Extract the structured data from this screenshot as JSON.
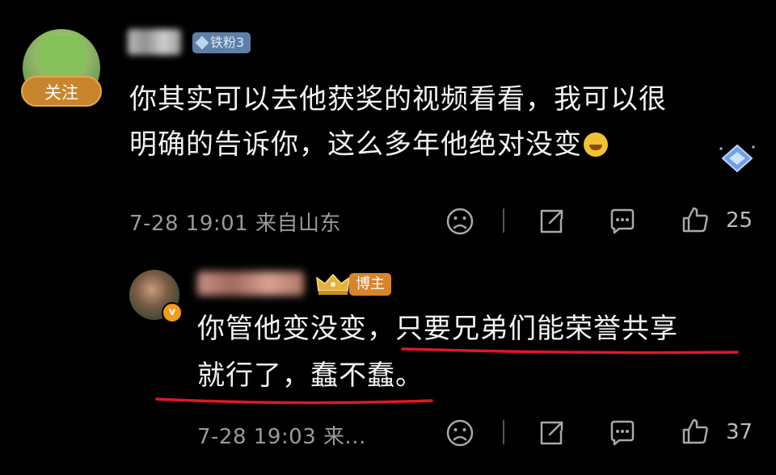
{
  "colors": {
    "background": "#000000",
    "follow": "#c9852d",
    "fan_badge": "#5f7fa8",
    "author_badge": "#d7842a",
    "underline": "#e0162b",
    "meta_text": "#9a9a9a"
  },
  "comment": {
    "follow_label": "关注",
    "fan_badge": "铁粉3",
    "text_line1": "你其实可以去他获奖的视频看看，我可以很",
    "text_line2": "明确的告诉你，这么多年他绝对没变",
    "emoji": "laughing-crying-emoji",
    "meta": "7-28 19:01  来自山东",
    "like_count": "25",
    "icons": [
      "dislike-icon",
      "share-icon",
      "comment-icon",
      "like-icon"
    ]
  },
  "reply": {
    "author_badge": "博主",
    "verified_badge": "v",
    "text_line1": "你管他变没变，只要兄弟们能荣誉共享",
    "text_line2": "就行了，蠢不蠢。",
    "meta": "7-28 19:03  来...",
    "like_count": "37",
    "icons": [
      "dislike-icon",
      "share-icon",
      "comment-icon",
      "like-icon"
    ]
  }
}
